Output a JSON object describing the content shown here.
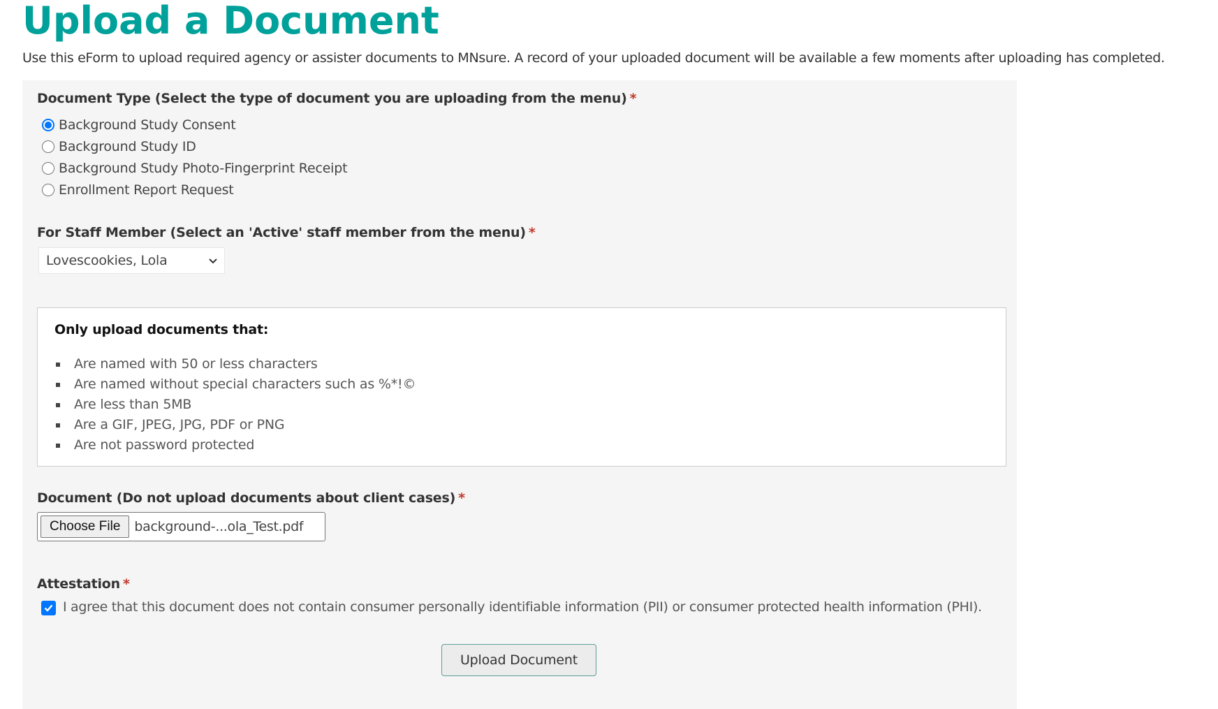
{
  "page": {
    "title": "Upload a Document",
    "intro": "Use this eForm to upload required agency or assister documents to MNsure. A record of your uploaded document will be available a few moments after uploading has completed.",
    "accent_color": "#00a19a"
  },
  "form": {
    "required_marker": "*",
    "document_type": {
      "label": "Document Type (Select the type of document you are uploading from the menu)",
      "selected_index": 0,
      "options": [
        {
          "label": "Background Study Consent",
          "checked": true
        },
        {
          "label": "Background Study ID",
          "checked": false
        },
        {
          "label": "Background Study Photo-Fingerprint Receipt",
          "checked": false
        },
        {
          "label": "Enrollment Report Request",
          "checked": false
        }
      ]
    },
    "staff_member": {
      "label": "For Staff Member (Select an 'Active' staff member from the menu)",
      "selected_value": "Lovescookies, Lola",
      "icon": "chevron-down-icon"
    },
    "notes": {
      "title": "Only upload documents that:",
      "items": [
        "Are named with 50 or less characters",
        "Are named without special characters such as %*!©",
        "Are less than 5MB",
        "Are a GIF, JPEG, JPG, PDF or PNG",
        "Are not password protected"
      ]
    },
    "document": {
      "label": "Document (Do not upload documents about client cases)",
      "choose_button_label": "Choose File",
      "file_name": "background-...ola_Test.pdf"
    },
    "attestation": {
      "label": "Attestation",
      "checked": true,
      "text": "I agree that this document does not contain consumer personally identifiable information (PII) or consumer protected health information (PHI)."
    },
    "submit_label": "Upload Document"
  }
}
